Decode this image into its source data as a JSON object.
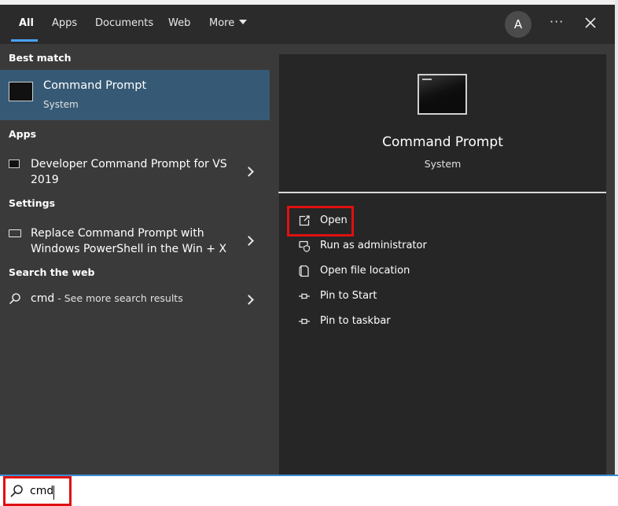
{
  "header": {
    "tabs": [
      {
        "label": "All",
        "active": true
      },
      {
        "label": "Apps"
      },
      {
        "label": "Documents"
      },
      {
        "label": "Web"
      },
      {
        "label": "More"
      }
    ],
    "avatar_initial": "A",
    "dots": "···"
  },
  "left": {
    "best_match_title": "Best match",
    "best_match": {
      "title": "Command Prompt",
      "subtitle": "System"
    },
    "apps_title": "Apps",
    "apps": [
      {
        "label": "Developer Command Prompt for VS 2019"
      }
    ],
    "settings_title": "Settings",
    "settings": [
      {
        "label": "Replace Command Prompt with Windows PowerShell in the Win + X"
      }
    ],
    "web_title": "Search the web",
    "web": {
      "query": "cmd",
      "suffix": " - See more search results"
    }
  },
  "preview": {
    "title": "Command Prompt",
    "subtitle": "System",
    "actions": [
      {
        "label": "Open",
        "icon": "open-icon"
      },
      {
        "label": "Run as administrator",
        "icon": "shield-icon"
      },
      {
        "label": "Open file location",
        "icon": "file-location-icon"
      },
      {
        "label": "Pin to Start",
        "icon": "pin-icon"
      },
      {
        "label": "Pin to taskbar",
        "icon": "pin-icon"
      }
    ]
  },
  "search": {
    "value": "cmd"
  },
  "colors": {
    "accent": "#4aa3ff",
    "selected_row": "#365a75",
    "highlight_box": "#e01010"
  }
}
